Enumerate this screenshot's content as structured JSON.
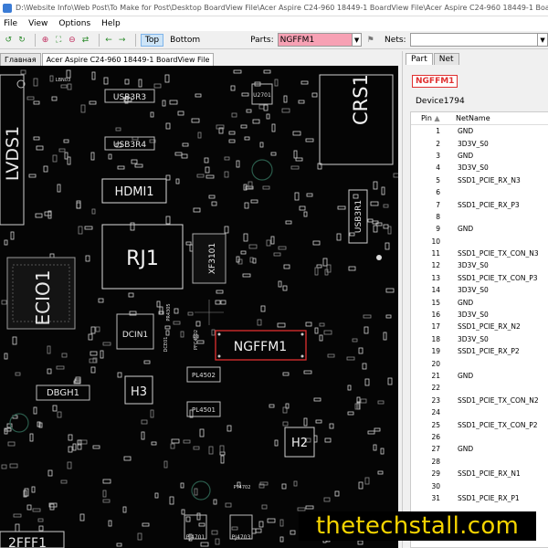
{
  "window": {
    "title": "D:\\Website Info\\Web Post\\To Make for Post\\Desktop BoardView File\\Acer Aspire C24-960 18449-1 BoardView File\\Acer Aspire C24-960 18449-1 BoardVi..."
  },
  "menu": {
    "items": [
      "File",
      "View",
      "Options",
      "Help"
    ]
  },
  "toolbar": {
    "top_label": "Top",
    "bottom_label": "Bottom",
    "parts_label": "Parts:",
    "parts_value": "NGFFM1",
    "nets_label": "Nets:"
  },
  "doc_tabs": [
    "Главная",
    "Acer Aspire C24-960 18449-1 BoardView File"
  ],
  "board": {
    "labels": [
      "LVDS1",
      "ECIO1",
      "RJ1",
      "HDMI1",
      "USB3R3",
      "USB3R4",
      "CRS1",
      "USB3R1",
      "XF3101",
      "NGFFM1",
      "DCIN1",
      "H3",
      "H2",
      "DBGH1",
      "U2701",
      "PL4502",
      "PL4501",
      "PJ4701",
      "PJ4703",
      "PR4305",
      "PT4702",
      "PFC4502",
      "DCE01",
      "LBN03",
      "2FFF1"
    ]
  },
  "panel": {
    "tabs": [
      "Part",
      "Net"
    ],
    "selected_part": "NGFFM1",
    "device": "Device1794",
    "columns": [
      "Pin",
      "NetName"
    ],
    "rows": [
      {
        "pin": "1",
        "net": "GND"
      },
      {
        "pin": "2",
        "net": "3D3V_S0"
      },
      {
        "pin": "3",
        "net": "GND"
      },
      {
        "pin": "4",
        "net": "3D3V_S0"
      },
      {
        "pin": "5",
        "net": "SSD1_PCIE_RX_N3"
      },
      {
        "pin": "6",
        "net": ""
      },
      {
        "pin": "7",
        "net": "SSD1_PCIE_RX_P3"
      },
      {
        "pin": "8",
        "net": ""
      },
      {
        "pin": "9",
        "net": "GND"
      },
      {
        "pin": "10",
        "net": ""
      },
      {
        "pin": "11",
        "net": "SSD1_PCIE_TX_CON_N3"
      },
      {
        "pin": "12",
        "net": "3D3V_S0"
      },
      {
        "pin": "13",
        "net": "SSD1_PCIE_TX_CON_P3"
      },
      {
        "pin": "14",
        "net": "3D3V_S0"
      },
      {
        "pin": "15",
        "net": "GND"
      },
      {
        "pin": "16",
        "net": "3D3V_S0"
      },
      {
        "pin": "17",
        "net": "SSD1_PCIE_RX_N2"
      },
      {
        "pin": "18",
        "net": "3D3V_S0"
      },
      {
        "pin": "19",
        "net": "SSD1_PCIE_RX_P2"
      },
      {
        "pin": "20",
        "net": ""
      },
      {
        "pin": "21",
        "net": "GND"
      },
      {
        "pin": "22",
        "net": ""
      },
      {
        "pin": "23",
        "net": "SSD1_PCIE_TX_CON_N2"
      },
      {
        "pin": "24",
        "net": ""
      },
      {
        "pin": "25",
        "net": "SSD1_PCIE_TX_CON_P2"
      },
      {
        "pin": "26",
        "net": ""
      },
      {
        "pin": "27",
        "net": "GND"
      },
      {
        "pin": "28",
        "net": ""
      },
      {
        "pin": "29",
        "net": "SSD1_PCIE_RX_N1"
      },
      {
        "pin": "30",
        "net": ""
      },
      {
        "pin": "31",
        "net": "SSD1_PCIE_RX_P1"
      }
    ]
  },
  "watermark": "thetechstall.com",
  "colors": {
    "board_bg": "#050505",
    "silkscreen": "#e8e8e8",
    "highlight": "#e03030",
    "parts_field": "#f7a1b4",
    "watermark_text": "#f5d400"
  }
}
